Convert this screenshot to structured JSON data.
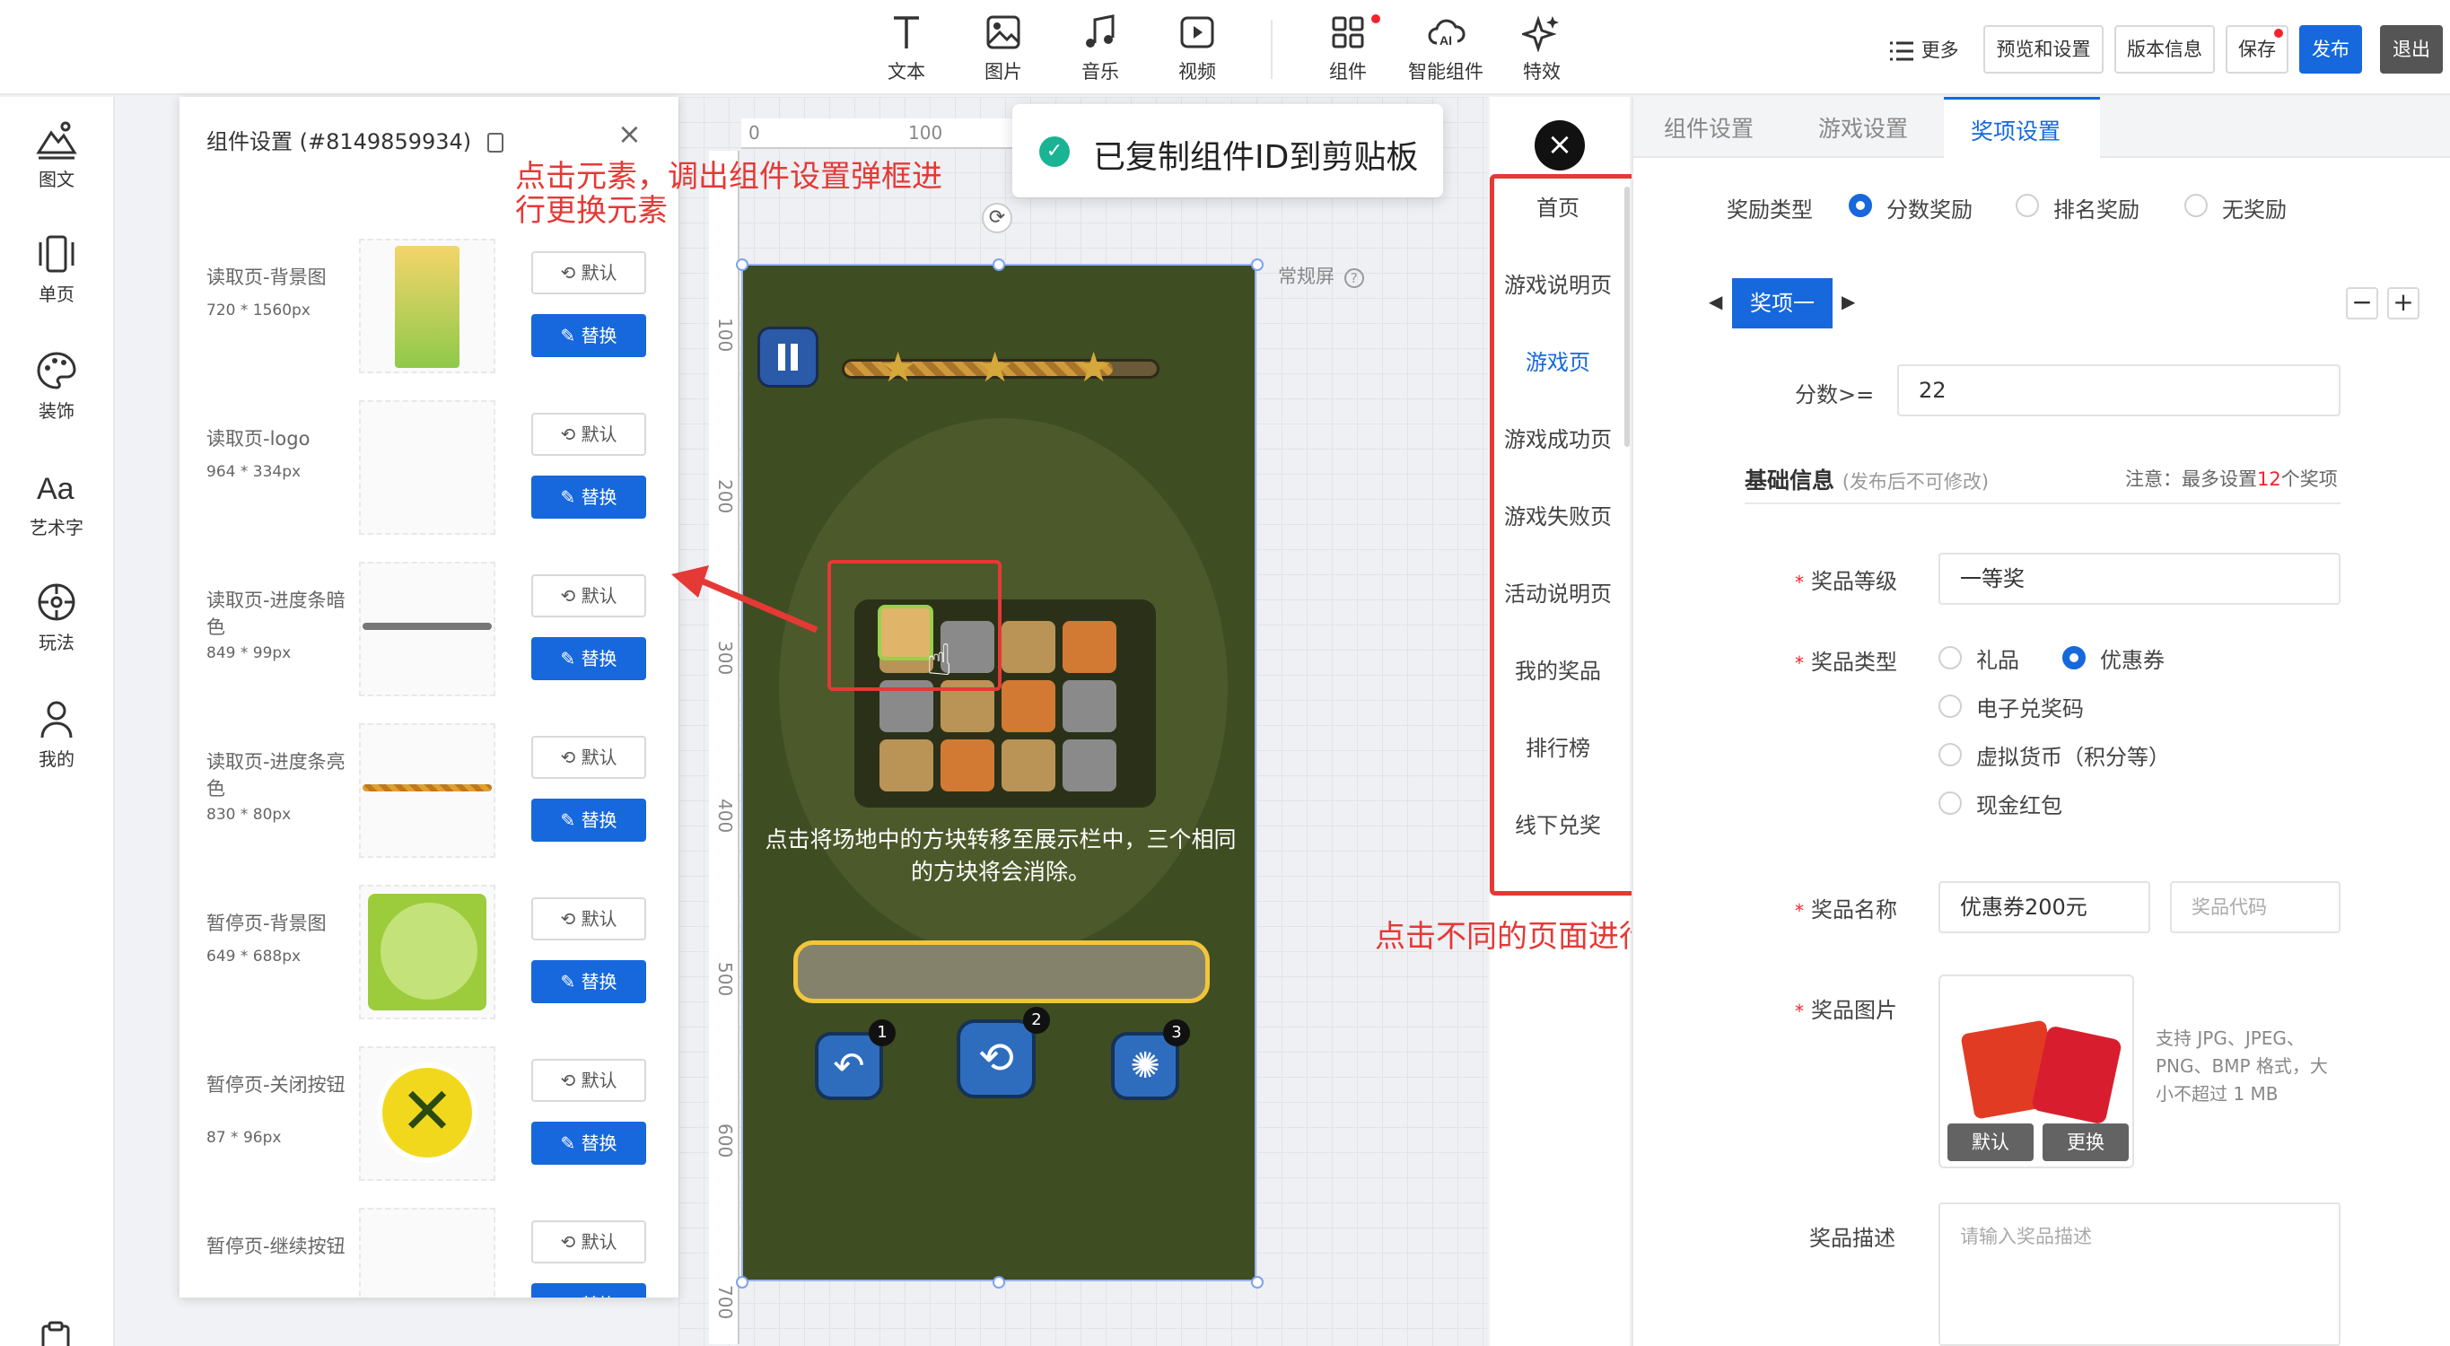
{
  "toolbar": {
    "tools": [
      {
        "label": "文本",
        "icon": "text-icon"
      },
      {
        "label": "图片",
        "icon": "image-icon"
      },
      {
        "label": "音乐",
        "icon": "music-icon"
      },
      {
        "label": "视频",
        "icon": "video-icon"
      },
      {
        "label": "组件",
        "icon": "grid-icon"
      },
      {
        "label": "智能组件",
        "icon": "ai-cloud-icon"
      },
      {
        "label": "特效",
        "icon": "sparkle-icon"
      }
    ],
    "more": "更多",
    "preview": "预览和设置",
    "version": "版本信息",
    "save": "保存",
    "publish": "发布",
    "exit": "退出"
  },
  "rail": [
    {
      "label": "图文",
      "icon": "mountain-icon"
    },
    {
      "label": "单页",
      "icon": "pages-icon"
    },
    {
      "label": "装饰",
      "icon": "palette-icon"
    },
    {
      "label": "艺术字",
      "icon": "font-aa-icon"
    },
    {
      "label": "玩法",
      "icon": "gameplay-icon"
    },
    {
      "label": "我的",
      "icon": "user-icon"
    }
  ],
  "component_panel": {
    "title": "组件设置 (#8149859934)",
    "default_label": "默认",
    "replace_label": "替换",
    "items": [
      {
        "name": "读取页-背景图",
        "size": "720 * 1560px"
      },
      {
        "name": "读取页-logo",
        "size": "964 * 334px"
      },
      {
        "name": "读取页-进度条暗色",
        "size": "849 * 99px"
      },
      {
        "name": "读取页-进度条亮色",
        "size": "830 * 80px"
      },
      {
        "name": "暂停页-背景图",
        "size": "649 * 688px"
      },
      {
        "name": "暂停页-关闭按钮",
        "size": "87 * 96px"
      },
      {
        "name": "暂停页-继续按钮",
        "size": ""
      }
    ]
  },
  "annotations": {
    "component_tip": "点击元素，调出组件设置弹框进行更换元素",
    "page_tip": "点击不同的页面进行设置"
  },
  "canvas": {
    "ruler_top": [
      "0",
      "100"
    ],
    "ruler_left": [
      "100",
      "200",
      "300",
      "400",
      "500",
      "600",
      "700"
    ],
    "screen_mode": "常规屏",
    "game_text": "点击将场地中的方块转移至展示栏中，三个相同的方块将会消除。",
    "badges": [
      "1",
      "2",
      "3"
    ]
  },
  "toast": {
    "text": "已复制组件ID到剪贴板"
  },
  "pages": [
    "首页",
    "游戏说明页",
    "游戏页",
    "游戏成功页",
    "游戏失败页",
    "活动说明页",
    "我的奖品",
    "排行榜",
    "线下兑奖"
  ],
  "active_page": "游戏页",
  "settings": {
    "tabs": [
      "组件设置",
      "游戏设置",
      "奖项设置"
    ],
    "active_tab": "奖项设置",
    "reward_type_label": "奖励类型",
    "reward_types": [
      "分数奖励",
      "排名奖励",
      "无奖励"
    ],
    "reward_item_tab": "奖项一",
    "score_label": "分数>=",
    "score_value": "22",
    "basic_info": "基础信息",
    "basic_info_note": "(发布后不可修改)",
    "limit_prefix": "注意：最多设置",
    "limit_value": "12",
    "limit_suffix": "个奖项",
    "prize_level_label": "奖品等级",
    "prize_level_value": "一等奖",
    "prize_type_label": "奖品类型",
    "prize_types": [
      "礼品",
      "优惠券",
      "电子兑奖码",
      "虚拟货币（积分等）",
      "现金红包"
    ],
    "prize_name_label": "奖品名称",
    "prize_name_value": "优惠券200元",
    "prize_code_placeholder": "奖品代码",
    "prize_image_label": "奖品图片",
    "image_hint": "支持 JPG、JPEG、PNG、BMP 格式，大小不超过 1 MB",
    "image_default": "默认",
    "image_change": "更换",
    "prize_desc_label": "奖品描述",
    "prize_desc_placeholder": "请输入奖品描述"
  },
  "colors": {
    "primary": "#1668dc",
    "annotation": "#e53935",
    "game_bg": "#3f4d22"
  }
}
